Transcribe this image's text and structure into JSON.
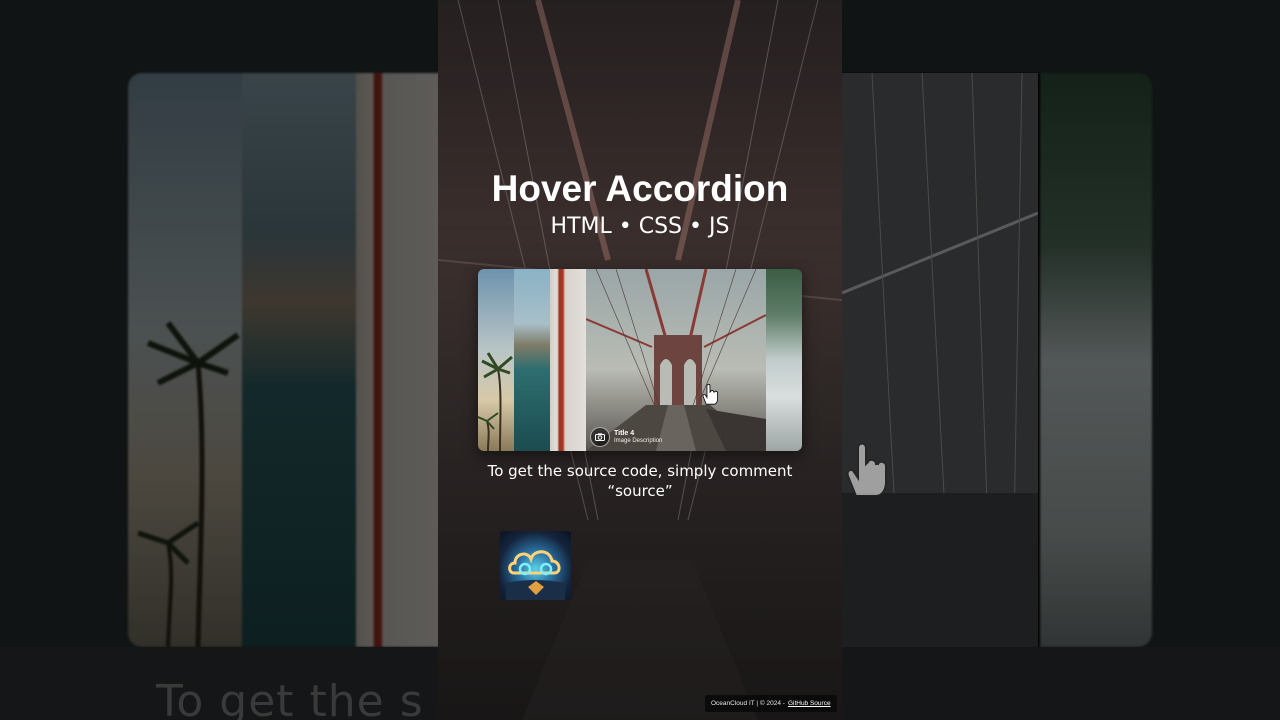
{
  "page": {
    "title": "Hover Accordion",
    "subtitle": "HTML • CSS • JS",
    "cta_line1": "To get the source code, simply comment",
    "cta_line2": "“source”",
    "background_caption": "To get the s                  ly comment"
  },
  "accordion": {
    "panels": [
      {
        "name": "palm-trees"
      },
      {
        "name": "coastal-cliffs"
      },
      {
        "name": "golden-gate-bridge"
      },
      {
        "name": "brooklyn-bridge",
        "caption_title": "Title 4",
        "caption_desc": "Image Description",
        "active": true
      },
      {
        "name": "misty-forest"
      }
    ]
  },
  "footer": {
    "text": "OceanCloud IT | © 2024 -",
    "link": "GitHub Source"
  },
  "icons": {
    "camera": "camera-icon",
    "cursor": "hand-pointer-icon",
    "logo": "oceancloud-logo"
  },
  "colors": {
    "title": "#ffffff",
    "background": "#111415",
    "bridge_red": "#a93826"
  }
}
